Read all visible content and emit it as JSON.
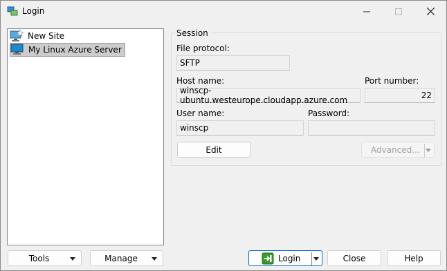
{
  "window": {
    "title": "Login",
    "icons": {
      "app": "winscp-login-icon",
      "minimize": "minimize-icon",
      "maximize": "maximize-icon",
      "close": "close-icon"
    }
  },
  "sites": {
    "items": [
      {
        "label": "New Site",
        "icon": "new-site-icon",
        "selected": false
      },
      {
        "label": "My Linux Azure Server",
        "icon": "site-computer-icon",
        "selected": true
      }
    ]
  },
  "session": {
    "group_label": "Session",
    "protocol_label": "File protocol:",
    "protocol_value": "SFTP",
    "host_label": "Host name:",
    "host_value": "winscp-ubuntu.westeurope.cloudapp.azure.com",
    "port_label": "Port number:",
    "port_value": "22",
    "user_label": "User name:",
    "user_value": "winscp",
    "password_label": "Password:",
    "password_value": "",
    "edit_label": "Edit",
    "advanced_label": "Advanced..."
  },
  "footer": {
    "tools_label": "Tools",
    "manage_label": "Manage",
    "login_label": "Login",
    "close_label": "Close",
    "help_label": "Help"
  },
  "colors": {
    "accent": "#0067c0",
    "login_icon_green": "#3c9a2e",
    "monitor_blue": "#1e88c8"
  }
}
